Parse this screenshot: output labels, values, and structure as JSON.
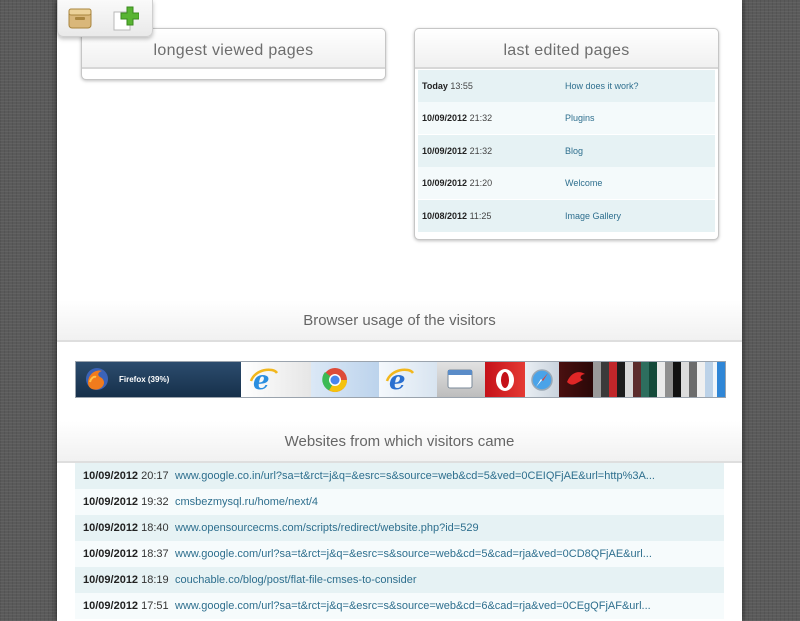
{
  "toolbar": {
    "icons": [
      "archive-icon",
      "add-icon"
    ]
  },
  "longest_viewed": {
    "title": "longest viewed pages"
  },
  "last_edited": {
    "title": "last edited pages",
    "rows": [
      {
        "date": "Today",
        "time": "13:55",
        "page": "How does it work?"
      },
      {
        "date": "10/09/2012",
        "time": "21:32",
        "page": "Plugins"
      },
      {
        "date": "10/09/2012",
        "time": "21:32",
        "page": "Blog"
      },
      {
        "date": "10/09/2012",
        "time": "21:20",
        "page": "Welcome"
      },
      {
        "date": "10/08/2012",
        "time": "11:25",
        "page": "Image Gallery"
      }
    ]
  },
  "browser_usage": {
    "title": "Browser usage of the visitors",
    "firefox_label": "Firefox (39%)",
    "browsers": [
      "firefox",
      "internet-explorer",
      "chrome",
      "internet-explorer",
      "other",
      "opera",
      "safari",
      "other"
    ]
  },
  "websites": {
    "title": "Websites from which visitors came",
    "rows": [
      {
        "date": "10/09/2012",
        "time": "20:17",
        "url": "www.google.co.in/url?sa=t&rct=j&q=&esrc=s&source=web&cd=5&ved=0CEIQFjAE&url=http%3A..."
      },
      {
        "date": "10/09/2012",
        "time": "19:32",
        "url": "cmsbezmysql.ru/home/next/4"
      },
      {
        "date": "10/09/2012",
        "time": "18:40",
        "url": "www.opensourcecms.com/scripts/redirect/website.php?id=529"
      },
      {
        "date": "10/09/2012",
        "time": "18:37",
        "url": "www.google.com/url?sa=t&rct=j&q=&esrc=s&source=web&cd=5&cad=rja&ved=0CD8QFjAE&url..."
      },
      {
        "date": "10/09/2012",
        "time": "18:19",
        "url": "couchable.co/blog/post/flat-file-cmses-to-consider"
      },
      {
        "date": "10/09/2012",
        "time": "17:51",
        "url": "www.google.com/url?sa=t&rct=j&q=&esrc=s&source=web&cd=6&cad=rja&ved=0CEgQFjAF&url..."
      }
    ]
  }
}
